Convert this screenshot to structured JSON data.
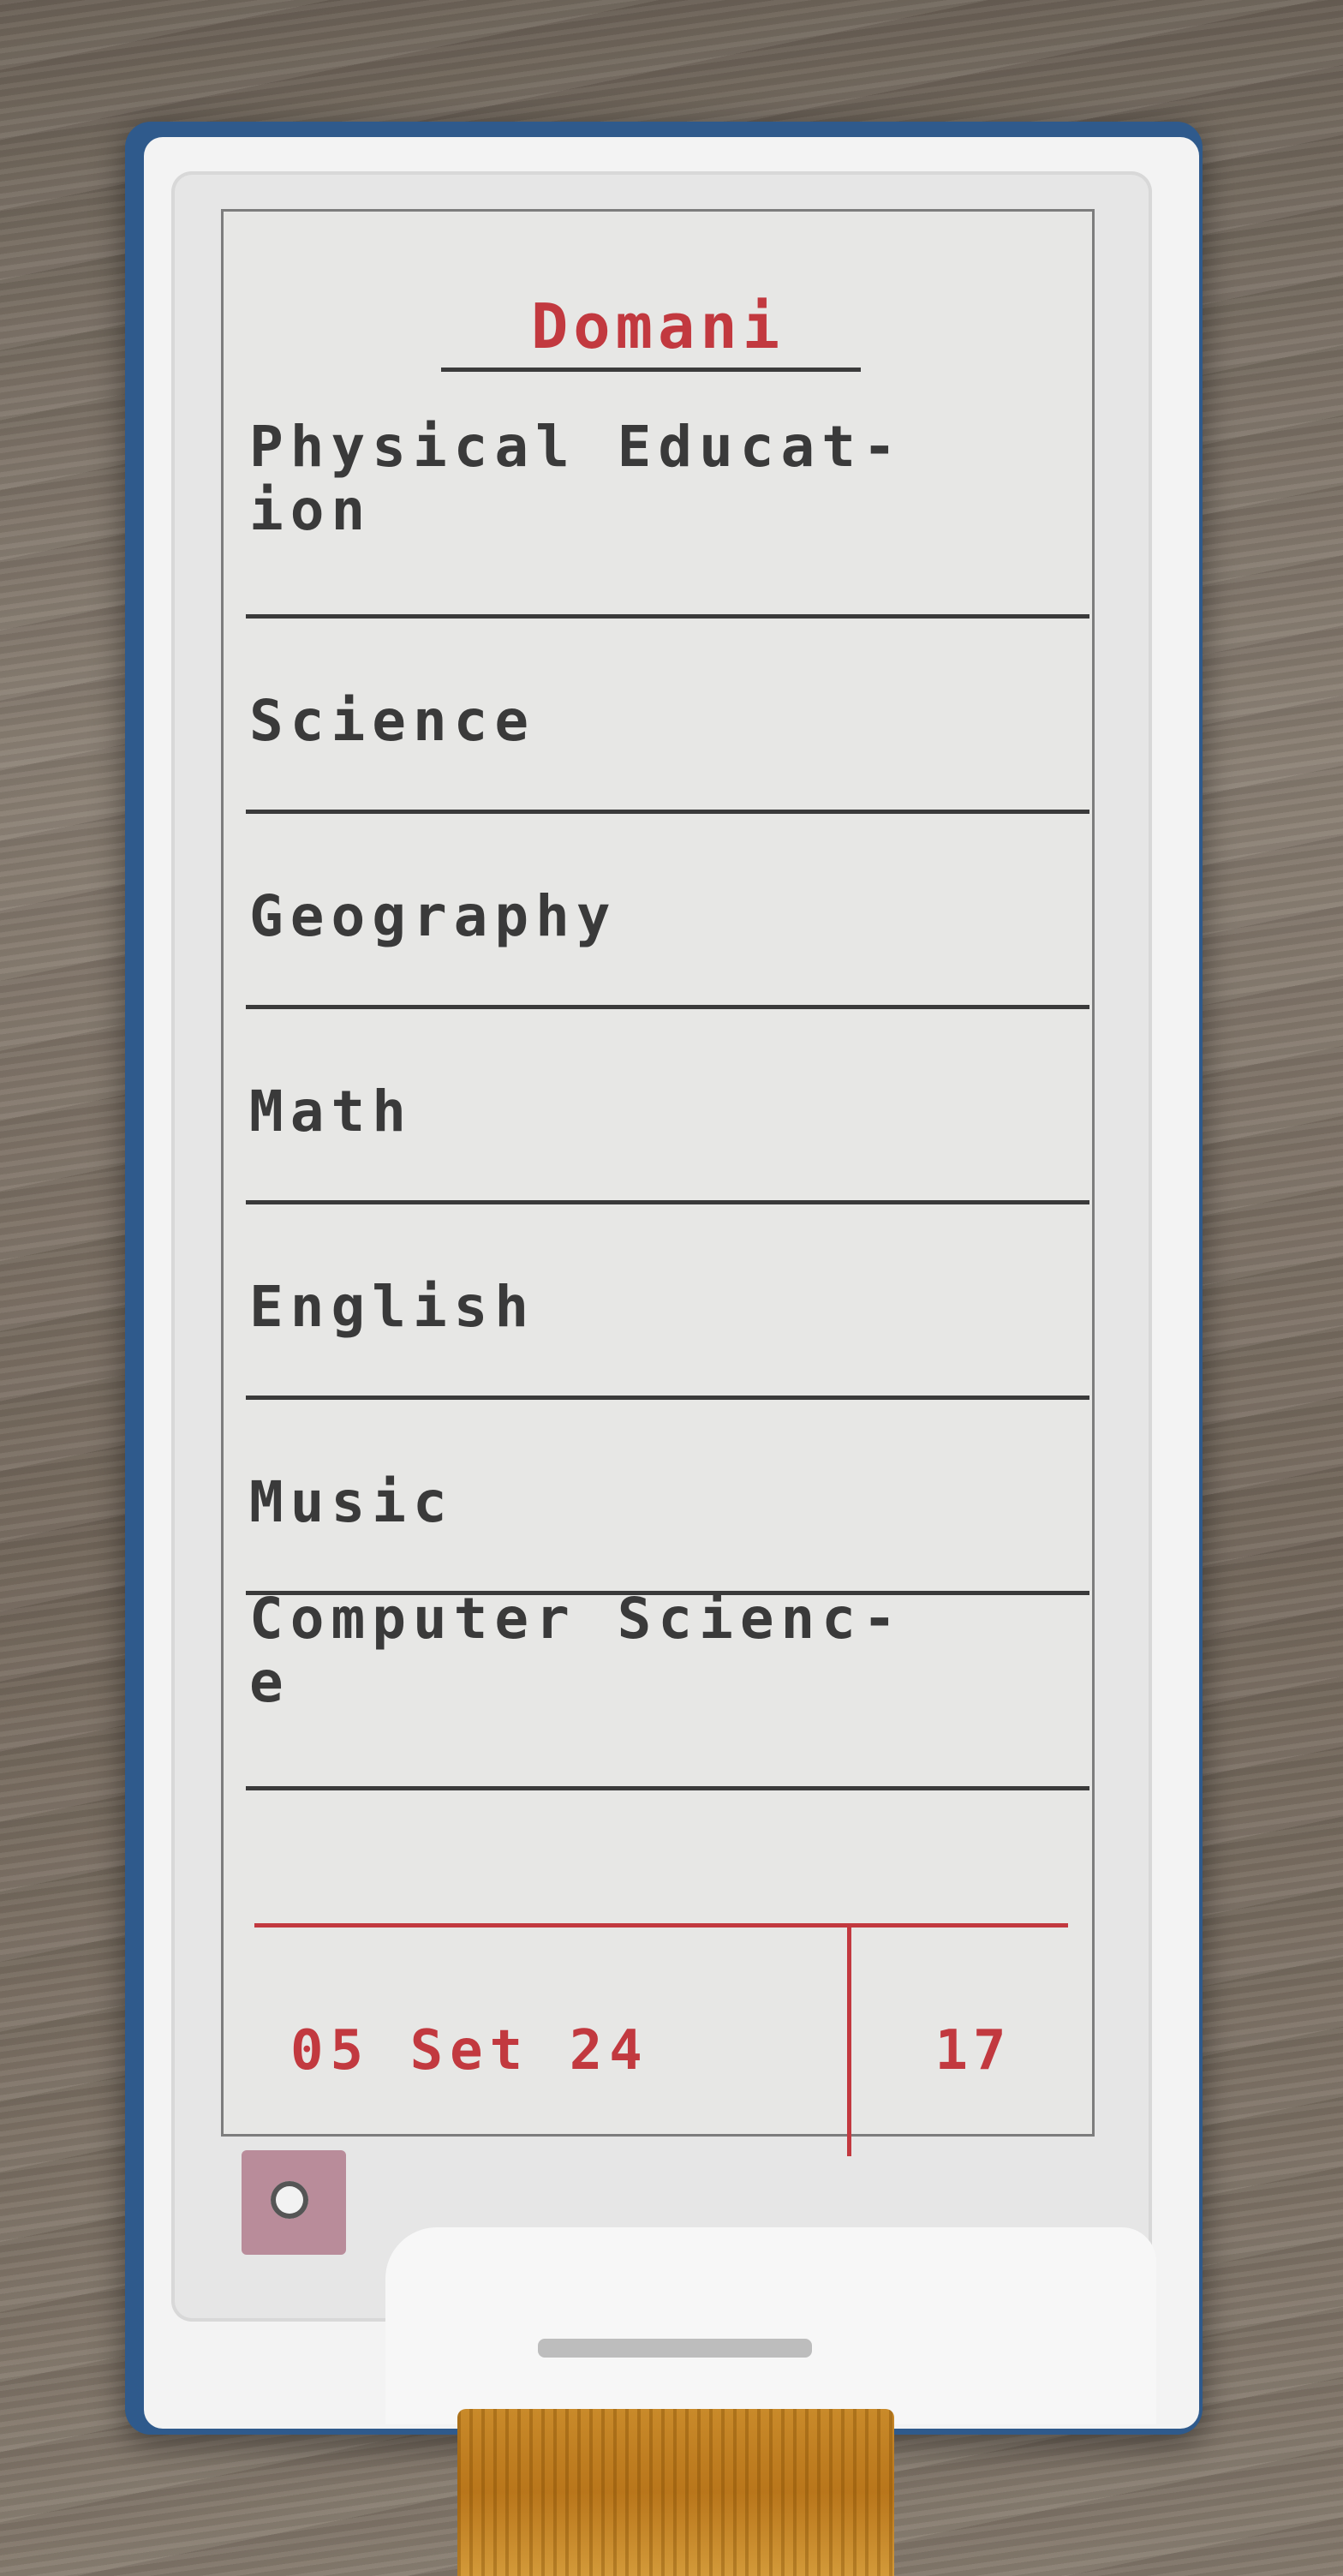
{
  "display": {
    "title": "Domani",
    "subjects": [
      "Physical Educat-\nion",
      "Science",
      "Geography",
      "Math",
      "English",
      "Music",
      "Computer Scienc-\ne"
    ],
    "footer": {
      "date": "05 Set 24",
      "page": "17"
    }
  },
  "colors": {
    "accent": "#c2393f",
    "text": "#3a3a3a",
    "eink_background": "#e7e7e5",
    "frame": "#2f5a8c"
  }
}
